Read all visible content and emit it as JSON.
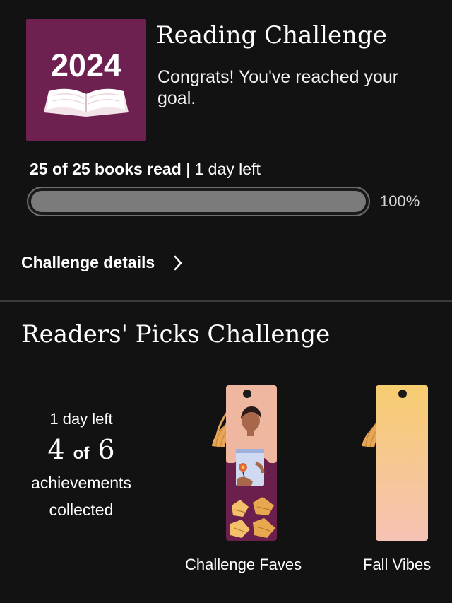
{
  "reading_challenge": {
    "badge_year": "2024",
    "title": "Reading Challenge",
    "congrats": "Congrats! You've reached your goal.",
    "progress_bold": "25 of 25 books read",
    "progress_rest": " | 1 day left",
    "progress_fraction": 1.0,
    "progress_percent": "100%",
    "details_link": "Challenge details"
  },
  "readers_picks": {
    "title": "Readers' Picks Challenge",
    "days_left": "1 day left",
    "achieved": "4",
    "of": "of",
    "total": "6",
    "label": "achievements collected",
    "bookmarks": [
      {
        "name": "Challenge Faves",
        "icon": "reader-bookmark-icon"
      },
      {
        "name": "Fall Vibes",
        "icon": "gradient-bookmark-icon"
      }
    ]
  },
  "colors": {
    "background": "#121212",
    "badge": "#6e2050",
    "bar_fill": "#7b7b7b",
    "bar_border": "#6e6e6e"
  }
}
